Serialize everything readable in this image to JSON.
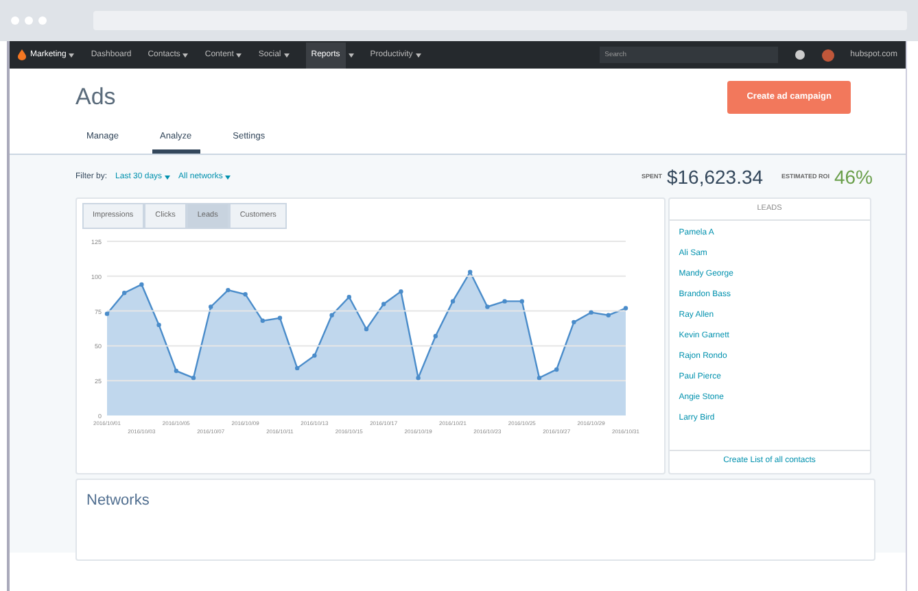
{
  "nav": {
    "items": [
      {
        "label": "Marketing",
        "dropdown": true,
        "selected": false
      },
      {
        "label": "Dashboard",
        "dropdown": false,
        "selected": false
      },
      {
        "label": "Contacts",
        "dropdown": true,
        "selected": false
      },
      {
        "label": "Content",
        "dropdown": true,
        "selected": false
      },
      {
        "label": "Social",
        "dropdown": true,
        "selected": false
      },
      {
        "label": "Reports",
        "dropdown": true,
        "selected": true
      },
      {
        "label": "Productivity",
        "dropdown": true,
        "selected": false
      }
    ],
    "search": {
      "placeholder": "Search"
    },
    "account": "hubspot.com"
  },
  "page": {
    "title": "Ads",
    "action": "Create ad campaign"
  },
  "tabs": [
    {
      "label": "Manage",
      "selected": false
    },
    {
      "label": "Analyze",
      "selected": true
    },
    {
      "label": "Settings",
      "selected": false
    }
  ],
  "filter": {
    "label": "Filter by:",
    "options": [
      "Last 30 days",
      "All networks"
    ]
  },
  "stats": [
    {
      "label": "SPENT",
      "value": "$16,623.34",
      "color": "#33475b"
    },
    {
      "label": "ESTIMATED ROI",
      "value": "46%",
      "color": "#6a9f4b"
    }
  ],
  "metric_tabs": [
    {
      "label": "Impressions",
      "selected": false
    },
    {
      "label": "Clicks",
      "selected": false
    },
    {
      "label": "Leads",
      "selected": true
    },
    {
      "label": "Customers",
      "selected": false
    }
  ],
  "chart_data": {
    "type": "area",
    "ylim": [
      0,
      125
    ],
    "yticks": [
      0,
      25,
      50,
      75,
      100,
      125
    ],
    "grid": true,
    "categories": [
      "2016/10/01",
      null,
      "2016/10/03",
      null,
      "2016/10/05",
      null,
      "2016/10/07",
      null,
      "2016/10/09",
      null,
      "2016/10/11",
      null,
      "2016/10/13",
      null,
      "2016/10/15",
      null,
      "2016/10/17",
      null,
      "2016/10/19",
      null,
      "2016/10/21",
      null,
      "2016/10/23",
      null,
      "2016/10/25",
      null,
      "2016/10/27",
      null,
      "2016/10/29",
      null,
      "2016/10/31"
    ],
    "series": [
      {
        "color": "#4a8cca",
        "values": [
          73,
          88,
          94,
          65,
          32,
          27,
          78,
          90,
          87,
          68,
          70,
          34,
          43,
          72,
          85,
          62,
          80,
          89,
          27,
          57,
          82,
          103,
          78,
          82,
          82,
          27,
          33,
          67,
          74,
          72,
          77
        ]
      }
    ]
  },
  "leads": {
    "title": "LEADS",
    "items": [
      "Pamela A",
      "Ali Sam",
      "Mandy George",
      "Brandon Bass",
      "Ray Allen",
      "Kevin Garnett",
      "Rajon Rondo",
      "Paul Pierce",
      "Angie Stone",
      "Larry Bird"
    ],
    "footer": "Create List of all contacts"
  },
  "networks": {
    "title": "Networks"
  }
}
